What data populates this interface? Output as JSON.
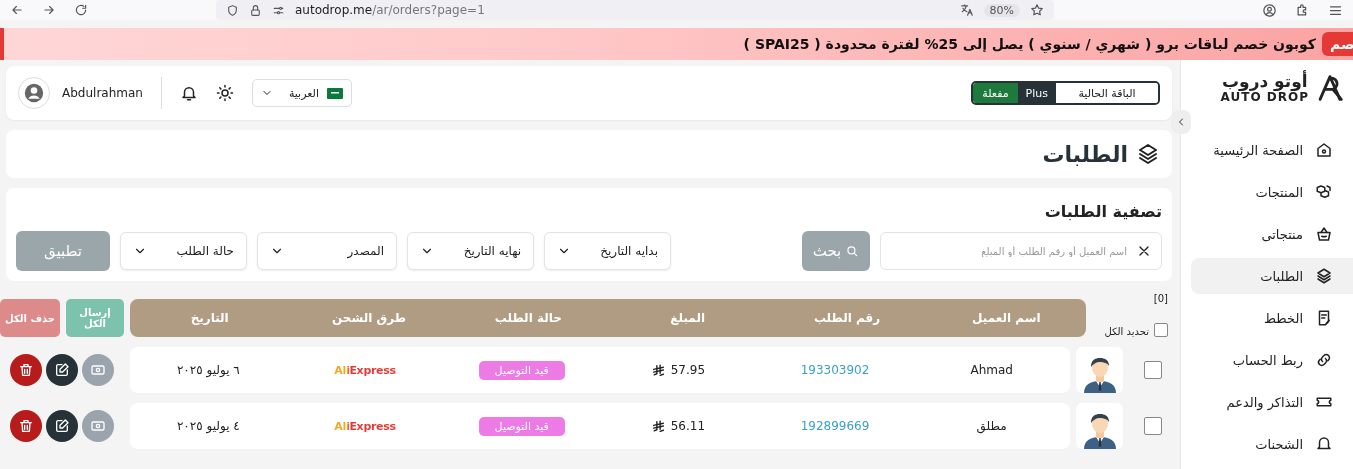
{
  "browser": {
    "url_host": "autodrop.me",
    "url_path": "/ar/orders?page=1",
    "zoom": "80%"
  },
  "banner": {
    "badge": "صم",
    "text": "كوبون خصم لباقات برو ( شهري / سنوي ) يصل إلى 25% لفترة محدودة ( SPAI25 )"
  },
  "sidebar": {
    "logo_ar": "أوتو دروب",
    "logo_en": "AUTO DROP",
    "items": [
      {
        "label": "الصفحة الرئيسية",
        "selected": false
      },
      {
        "label": "المنتجات",
        "selected": false
      },
      {
        "label": "منتجاتى",
        "selected": false
      },
      {
        "label": "الطلبات",
        "selected": true
      },
      {
        "label": "الخطط",
        "selected": false
      },
      {
        "label": "ربط الحساب",
        "selected": false
      },
      {
        "label": "التذاكر والدعم",
        "selected": false
      },
      {
        "label": "الشحنات",
        "selected": false
      }
    ]
  },
  "header": {
    "plan_label": "الباقة الحالية",
    "plan_name": "Plus",
    "plan_status": "مفعلة",
    "language": "العربية",
    "user": "Abdulrahman"
  },
  "page_title": "الطلبات",
  "filter": {
    "title": "تصفية الطلبات",
    "search_placeholder": "اسم العميل أو رقم الطلب أو المبلغ",
    "search_button": "بحث",
    "dropdowns": [
      "بدايه التاريخ",
      "نهايه التاريخ",
      "المصدر",
      "حالة الطلب"
    ],
    "apply_button": "تطبيق"
  },
  "table": {
    "select_count": "[0]",
    "select_all": "تحديد الكل",
    "select_all_checked": false,
    "columns": [
      "اسم العميل",
      "رقم الطلب",
      "المبلغ",
      "حالة الطلب",
      "طرق الشحن",
      "التاريخ"
    ],
    "send_all": "إرسال الكل",
    "delete_all": "حذف الكل",
    "rows": [
      {
        "checked": false,
        "customer": "Ahmad",
        "order_number": "193303902",
        "amount": "57.95",
        "status": "قيد التوصيل",
        "shipping": "AliExpress",
        "date": "٦ يوليو ٢٠٢٥"
      },
      {
        "checked": false,
        "customer": "مطلق",
        "order_number": "192899669",
        "amount": "56.11",
        "status": "قيد التوصيل",
        "shipping": "AliExpress",
        "date": "٤ يوليو ٢٠٢٥"
      }
    ]
  }
}
